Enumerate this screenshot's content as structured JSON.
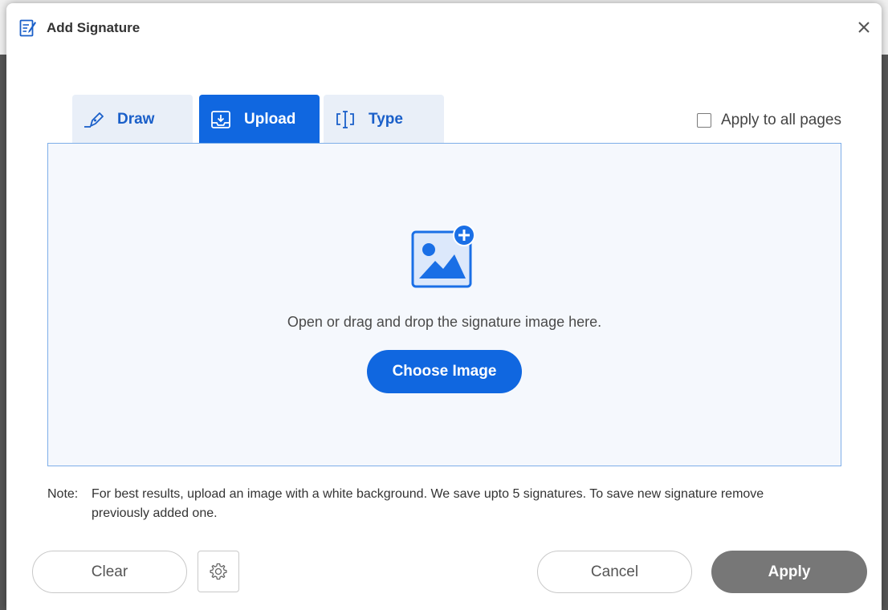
{
  "dialog": {
    "title": "Add Signature",
    "title_icon": "signature-document-icon",
    "close_icon": "close-icon"
  },
  "tabs": [
    {
      "label": "Draw",
      "icon": "pen-draw-icon",
      "active": false
    },
    {
      "label": "Upload",
      "icon": "upload-icon",
      "active": true
    },
    {
      "label": "Type",
      "icon": "text-cursor-icon",
      "active": false
    }
  ],
  "apply_all": {
    "label": "Apply to all pages",
    "checked": false
  },
  "drop_zone": {
    "icon": "add-image-icon",
    "instruction": "Open or drag and drop the signature image here.",
    "choose_button": "Choose Image"
  },
  "note": {
    "label": "Note:",
    "text": "For best results, upload an image with a white background. We save upto 5 signatures. To save new signature remove previously added one."
  },
  "footer": {
    "clear_label": "Clear",
    "settings_icon": "gear-icon",
    "cancel_label": "Cancel",
    "apply_label": "Apply"
  },
  "colors": {
    "accent": "#1067e0",
    "tab_inactive_bg": "#e9eff8",
    "drop_zone_bg": "#f5f8fd",
    "drop_zone_border": "#7eaee8",
    "apply_disabled": "#777777"
  }
}
